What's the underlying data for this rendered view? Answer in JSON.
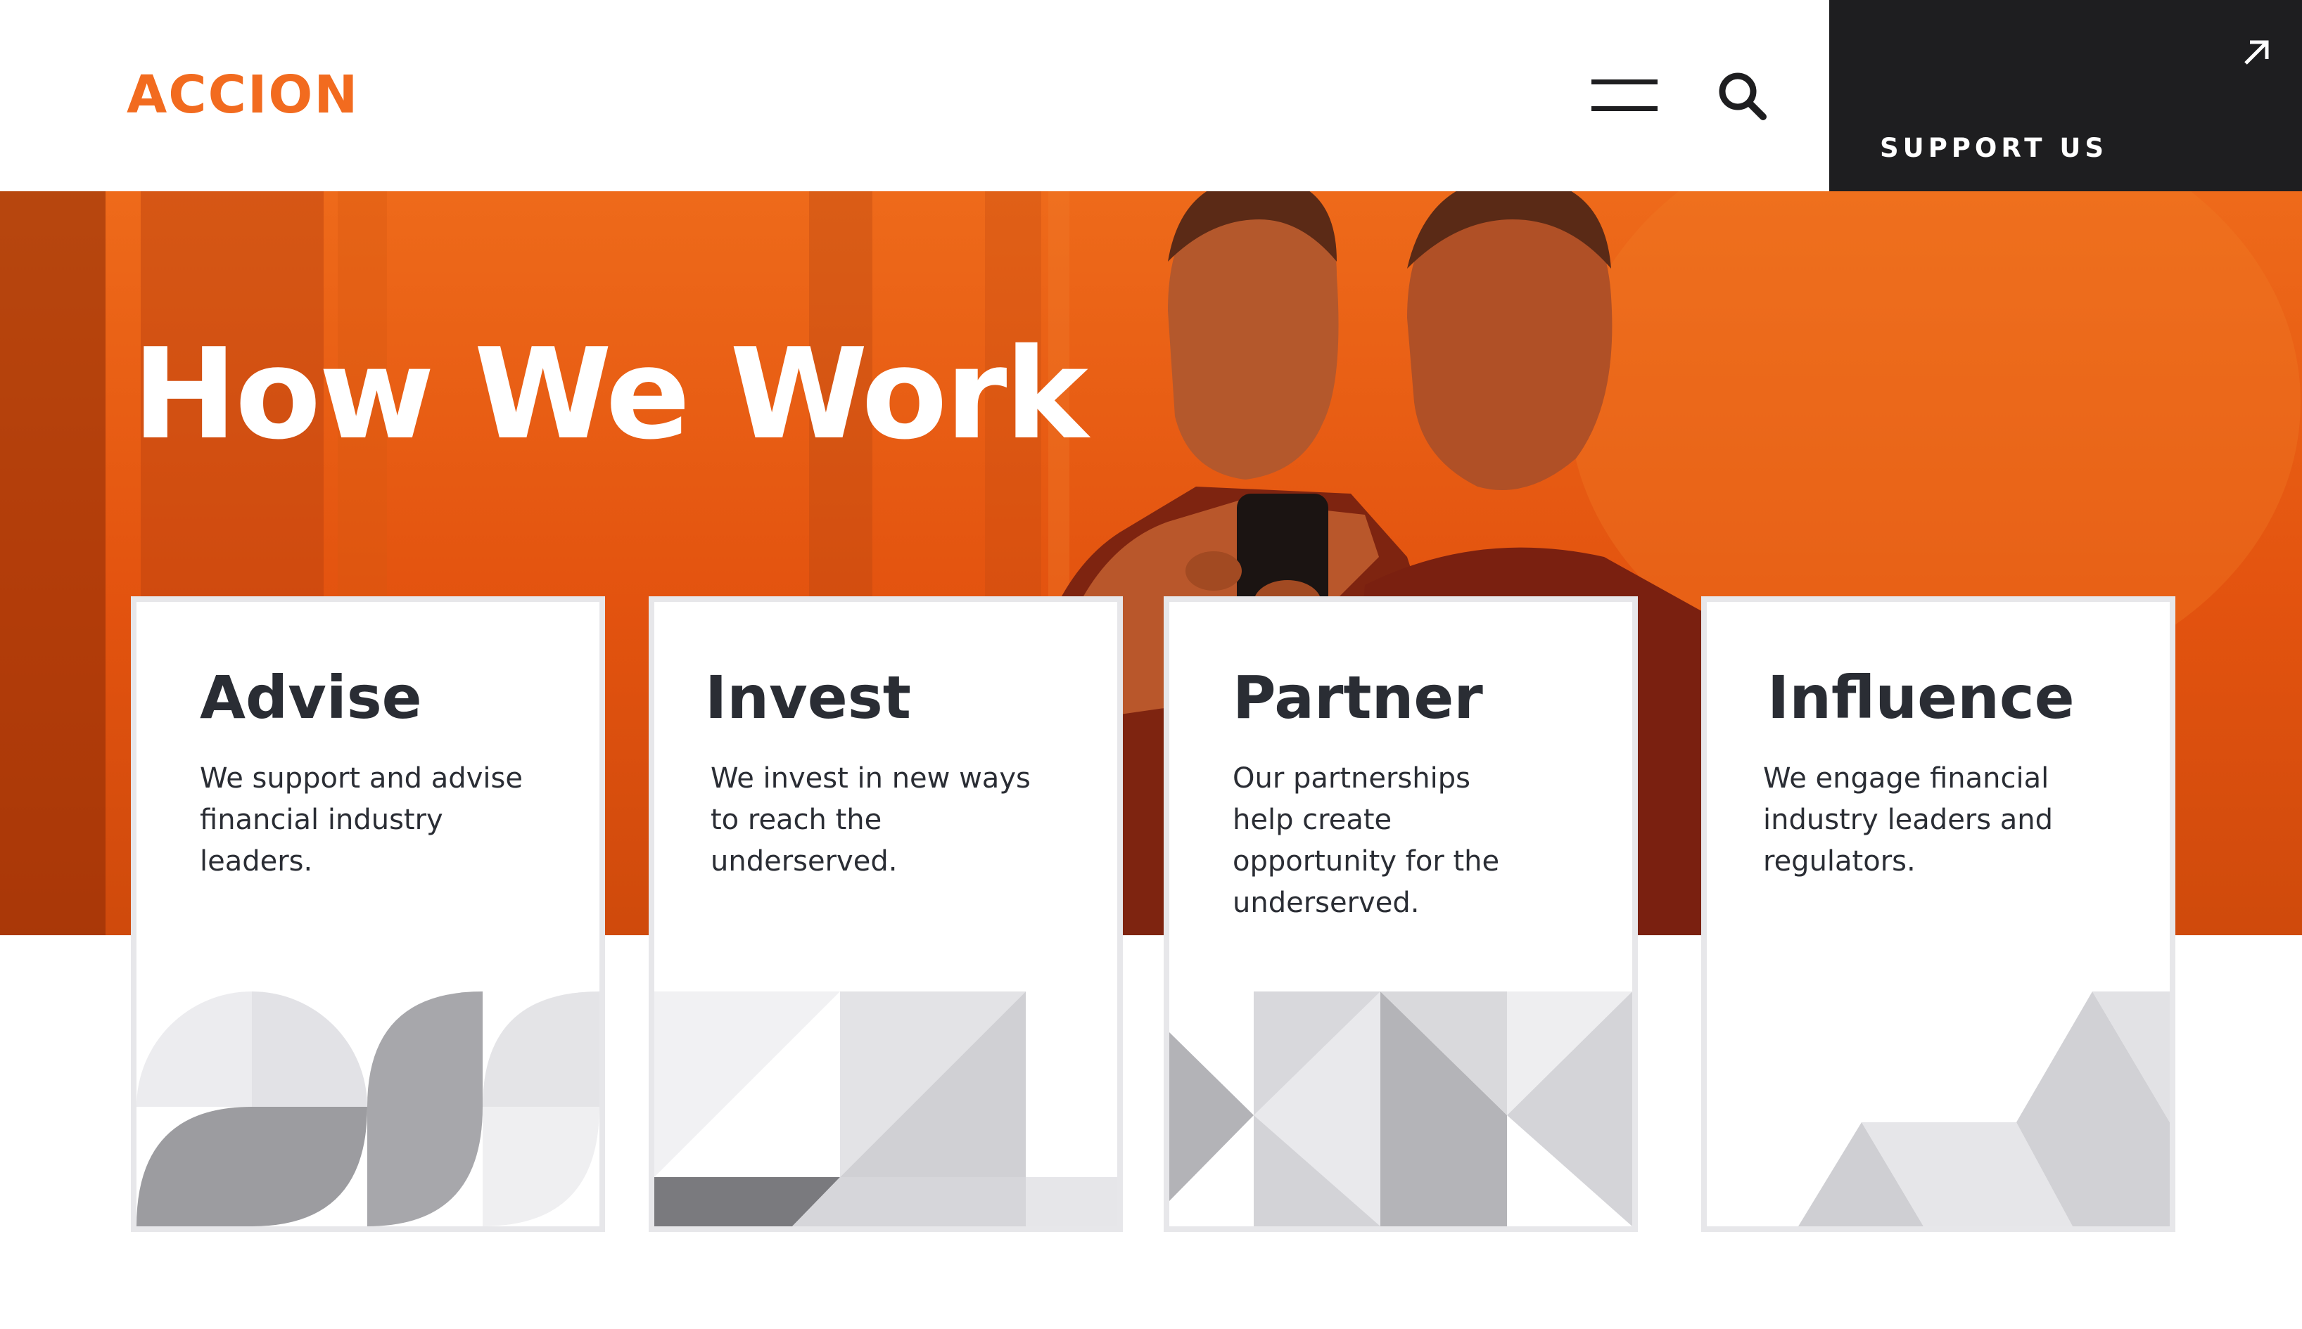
{
  "header": {
    "logo": "ACCION",
    "support_label": "SUPPORT US"
  },
  "hero": {
    "title": "How We Work"
  },
  "cards": [
    {
      "title": "Advise",
      "text": "We support and advise financial industry leaders."
    },
    {
      "title": "Invest",
      "text": "We invest in new ways to reach the underserved."
    },
    {
      "title": "Partner",
      "text": "Our partnerships help create opportunity for the underserved."
    },
    {
      "title": "Influence",
      "text": "We engage financial industry leaders and regulators."
    }
  ],
  "colors": {
    "brand_orange": "#f26b1f",
    "dark": "#1e1e20"
  },
  "icons": [
    "hamburger-menu-icon",
    "search-icon",
    "external-arrow-icon"
  ]
}
